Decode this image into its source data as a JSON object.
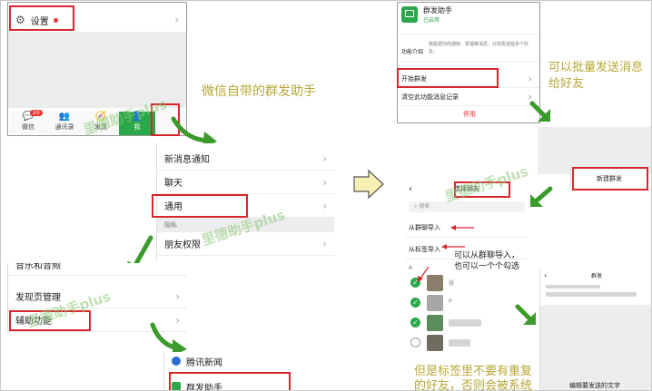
{
  "left": {
    "settings_label": "设置",
    "tabs": [
      {
        "label": "微信",
        "badge": "20"
      },
      {
        "label": "通讯录",
        "badge": ""
      },
      {
        "label": "发现",
        "badge": ""
      },
      {
        "label": "我",
        "badge": ""
      }
    ],
    "settings_list": {
      "item1": "新消息通知",
      "item2": "聊天",
      "item3": "通用",
      "section": "隐私",
      "item4": "朋友权限"
    },
    "general_list": {
      "item1": "音乐和音频",
      "item2": "发现页管理",
      "item3": "辅助功能"
    },
    "plugins": {
      "item1": "腾讯新闻",
      "item2": "群发助手"
    },
    "annotation": "微信自带的群发助手",
    "watermark": "里德助手plus"
  },
  "right": {
    "header_title": "群发助手",
    "header_status": "已启用",
    "intro_label": "功能介绍",
    "intro_text": "我能把你的通知、祝福等消息，分别发送给多个好友。",
    "start_label": "开始群发",
    "clear_label": "清空此功能消息记录",
    "disable_label": "停用",
    "annotation1": "可以批量发送消息给好友",
    "new_group_button": "新建群发",
    "select_title": "选择朋友",
    "search_placeholder": "搜索",
    "import_group": "从群聊导入",
    "import_tag": "从标签导入",
    "annotation2_l1": "可以从群聊导入，",
    "annotation2_l2": "也可以一个个勾选",
    "index_letter": "A",
    "contacts": [
      "张",
      "P",
      "",
      ""
    ],
    "send_title": "群发",
    "compose_hint": "编辑要发送的文字",
    "annotation3_l1": "但是标签里不要有重复",
    "annotation3_l2": "的好友，否则会被系统",
    "watermark": "里德助手plus"
  },
  "colors": {
    "accent_red": "#d9262c",
    "wechat_green": "#2aa84a",
    "annotation_yellow": "#b7a634",
    "arrow_green": "#3a9a2a"
  }
}
